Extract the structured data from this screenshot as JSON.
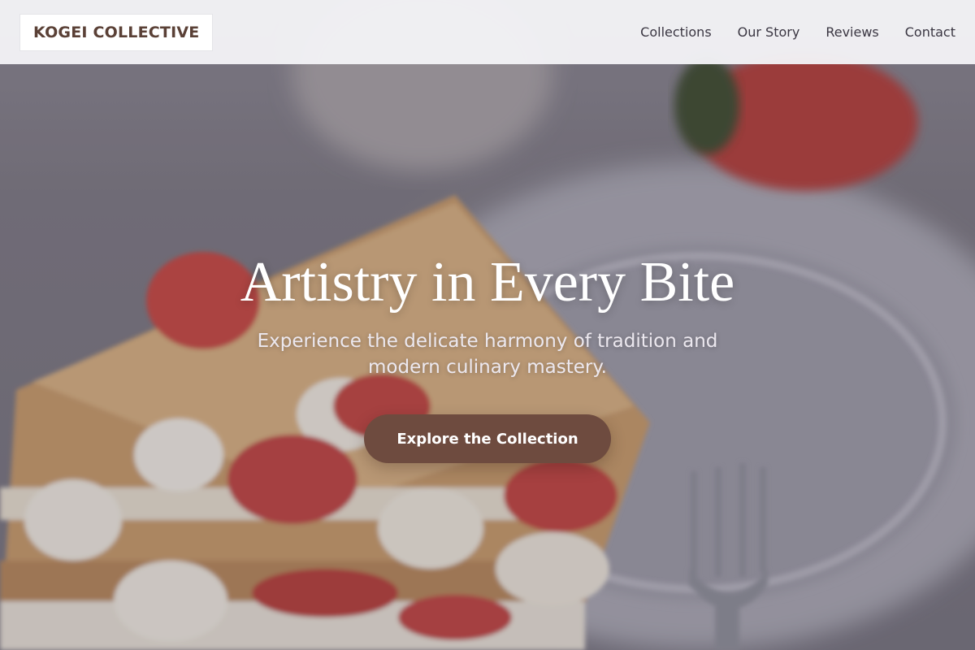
{
  "nav": {
    "logo": "KOGEI COLLECTIVE",
    "links": [
      "Collections",
      "Our Story",
      "Reviews",
      "Contact"
    ]
  },
  "hero": {
    "title": "Artistry in Every Bite",
    "subtitle": "Experience the delicate harmony of tradition and modern culinary mastery.",
    "cta_label": "Explore the Collection",
    "background": "pastry-photo-background"
  },
  "colors": {
    "brand_text": "#5a4036",
    "cta_background": "#6e4b3f",
    "nav_background": "#f3f3f6",
    "nav_text": "#3a3642"
  }
}
